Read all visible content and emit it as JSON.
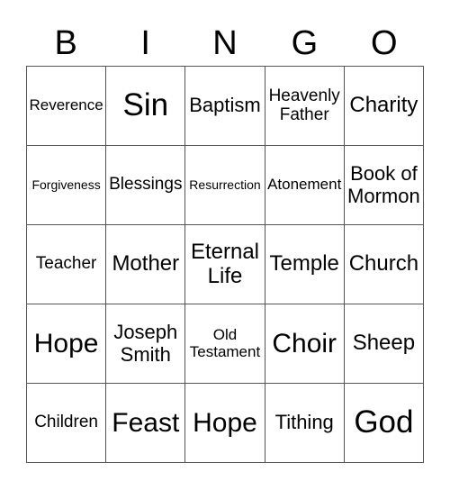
{
  "header": {
    "letters": [
      "B",
      "I",
      "N",
      "G",
      "O"
    ]
  },
  "card": {
    "cells": [
      [
        "Reverence",
        "Sin",
        "Baptism",
        "Heavenly Father",
        "Charity"
      ],
      [
        "Forgiveness",
        "Blessings",
        "Resurrection",
        "Atonement",
        "Book of Mormon"
      ],
      [
        "Teacher",
        "Mother",
        "Eternal Life",
        "Temple",
        "Church"
      ],
      [
        "Hope",
        "Joseph Smith",
        "Old Testament",
        "Choir",
        "Sheep"
      ],
      [
        "Children",
        "Feast",
        "Hope",
        "Tithing",
        "God"
      ]
    ]
  }
}
